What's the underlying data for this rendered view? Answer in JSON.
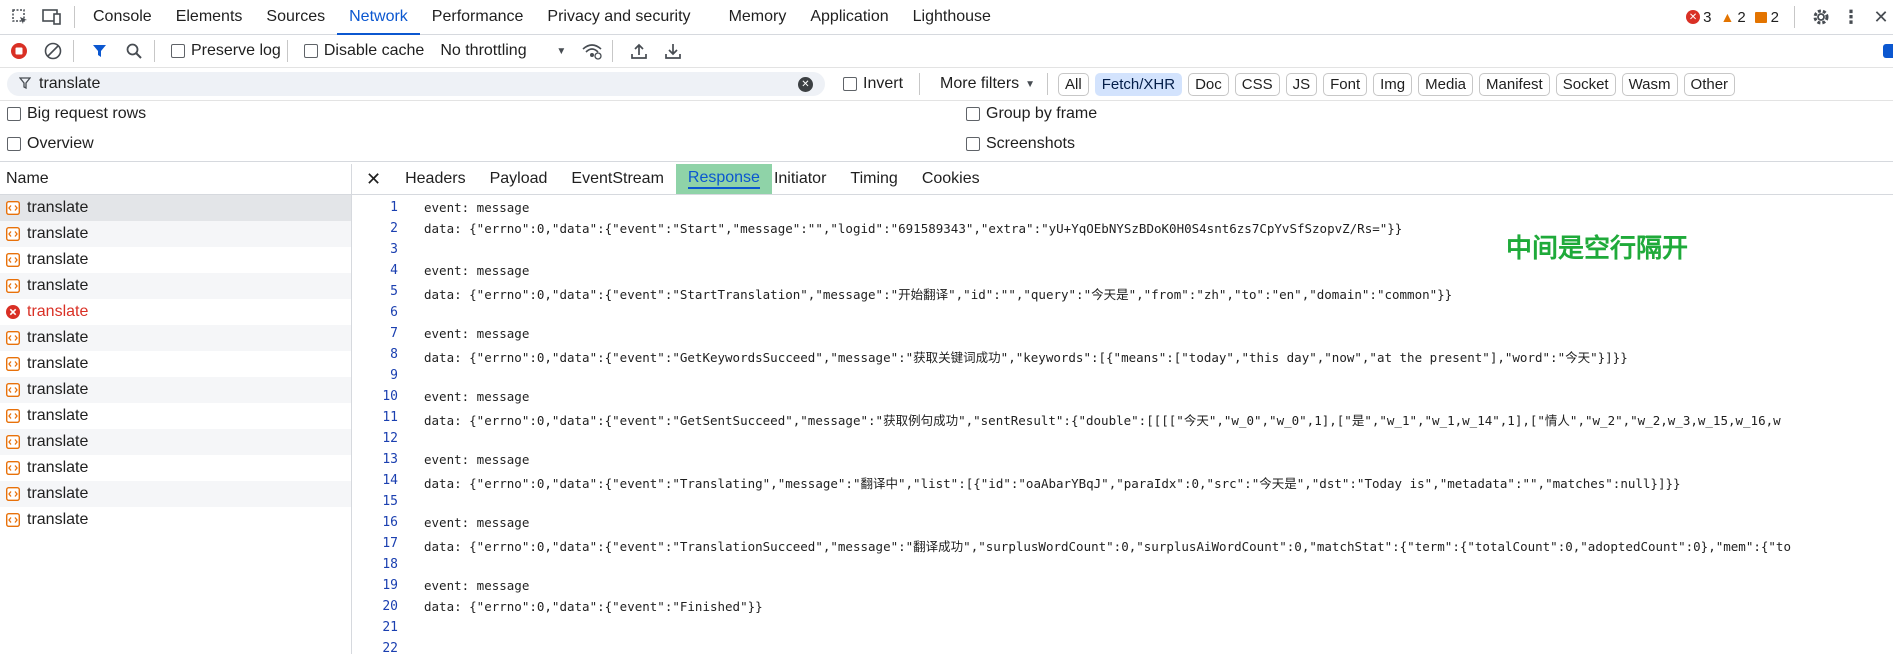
{
  "topbar": {
    "tabs": [
      "Console",
      "Elements",
      "Sources",
      "Network",
      "Performance",
      "Privacy and security",
      "Memory",
      "Application",
      "Lighthouse"
    ],
    "active_tab": "Network",
    "errors": "3",
    "warnings": "2",
    "issues": "2"
  },
  "toolbar": {
    "preserve_log": "Preserve log",
    "disable_cache": "Disable cache",
    "throttling": "No throttling"
  },
  "filter": {
    "value": "translate",
    "invert": "Invert",
    "more_filters": "More filters",
    "chips": [
      "All",
      "Fetch/XHR",
      "Doc",
      "CSS",
      "JS",
      "Font",
      "Img",
      "Media",
      "Manifest",
      "Socket",
      "Wasm",
      "Other"
    ],
    "selected_chip": "Fetch/XHR"
  },
  "settings": {
    "big_request_rows": "Big request rows",
    "overview": "Overview",
    "group_by_frame": "Group by frame",
    "screenshots": "Screenshots"
  },
  "requests": {
    "header": "Name",
    "items": [
      "translate",
      "translate",
      "translate",
      "translate",
      "translate",
      "translate",
      "translate",
      "translate",
      "translate",
      "translate",
      "translate",
      "translate",
      "translate"
    ],
    "error_index": 4
  },
  "detail": {
    "tabs": [
      "Headers",
      "Payload",
      "EventStream",
      "Response",
      "Initiator",
      "Timing",
      "Cookies"
    ],
    "active_tab": "Response",
    "lines": [
      {
        "n": "1",
        "t": "event: message"
      },
      {
        "n": "2",
        "t": "data: {\"errno\":0,\"data\":{\"event\":\"Start\",\"message\":\"\",\"logid\":\"691589343\",\"extra\":\"yU+YqOEbNYSzBDoK0H0S4snt6zs7CpYvSfSzopvZ/Rs=\"}}"
      },
      {
        "n": "3",
        "t": ""
      },
      {
        "n": "4",
        "t": "event: message"
      },
      {
        "n": "5",
        "t": "data: {\"errno\":0,\"data\":{\"event\":\"StartTranslation\",\"message\":\"开始翻译\",\"id\":\"\",\"query\":\"今天是\",\"from\":\"zh\",\"to\":\"en\",\"domain\":\"common\"}}"
      },
      {
        "n": "6",
        "t": ""
      },
      {
        "n": "7",
        "t": "event: message"
      },
      {
        "n": "8",
        "t": "data: {\"errno\":0,\"data\":{\"event\":\"GetKeywordsSucceed\",\"message\":\"获取关键词成功\",\"keywords\":[{\"means\":[\"today\",\"this day\",\"now\",\"at the present\"],\"word\":\"今天\"}]}}"
      },
      {
        "n": "9",
        "t": ""
      },
      {
        "n": "10",
        "t": "event: message"
      },
      {
        "n": "11",
        "t": "data: {\"errno\":0,\"data\":{\"event\":\"GetSentSucceed\",\"message\":\"获取例句成功\",\"sentResult\":{\"double\":[[[[\"今天\",\"w_0\",\"w_0\",1],[\"是\",\"w_1\",\"w_1,w_14\",1],[\"情人\",\"w_2\",\"w_2,w_3,w_15,w_16,w"
      },
      {
        "n": "12",
        "t": ""
      },
      {
        "n": "13",
        "t": "event: message"
      },
      {
        "n": "14",
        "t": "data: {\"errno\":0,\"data\":{\"event\":\"Translating\",\"message\":\"翻译中\",\"list\":[{\"id\":\"oaAbarYBqJ\",\"paraIdx\":0,\"src\":\"今天是\",\"dst\":\"Today is\",\"metadata\":\"\",\"matches\":null}]}}"
      },
      {
        "n": "15",
        "t": ""
      },
      {
        "n": "16",
        "t": "event: message"
      },
      {
        "n": "17",
        "t": "data: {\"errno\":0,\"data\":{\"event\":\"TranslationSucceed\",\"message\":\"翻译成功\",\"surplusWordCount\":0,\"surplusAiWordCount\":0,\"matchStat\":{\"term\":{\"totalCount\":0,\"adoptedCount\":0},\"mem\":{\"to"
      },
      {
        "n": "18",
        "t": ""
      },
      {
        "n": "19",
        "t": "event: message"
      },
      {
        "n": "20",
        "t": "data: {\"errno\":0,\"data\":{\"event\":\"Finished\"}}"
      },
      {
        "n": "21",
        "t": ""
      },
      {
        "n": "22",
        "t": ""
      }
    ]
  },
  "annotation": "中间是空行隔开"
}
